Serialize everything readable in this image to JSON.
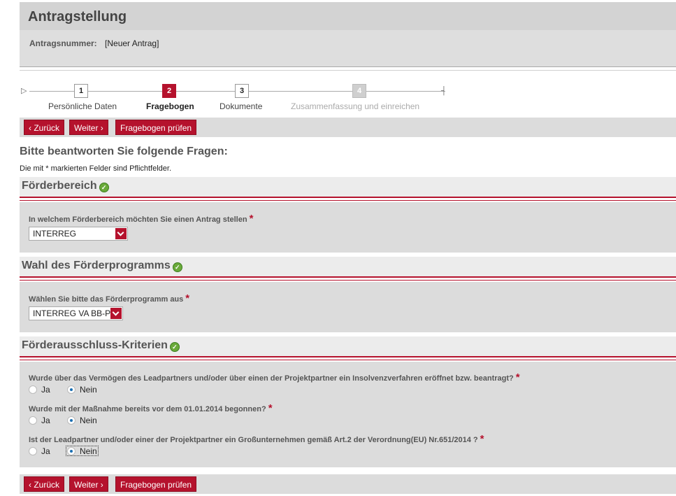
{
  "header": {
    "title": "Antragstellung",
    "antragsnummer_label": "Antragsnummer:",
    "antragsnummer_value": "[Neuer Antrag]"
  },
  "stepper": {
    "steps": [
      {
        "number": "1",
        "label": "Persönliche Daten",
        "state": "done"
      },
      {
        "number": "2",
        "label": "Fragebogen",
        "state": "active"
      },
      {
        "number": "3",
        "label": "Dokumente",
        "state": "available"
      },
      {
        "number": "4",
        "label": "Zusammenfassung und einreichen",
        "state": "disabled"
      }
    ]
  },
  "buttons": {
    "back": "Zurück",
    "next": "Weiter",
    "check": "Fragebogen prüfen"
  },
  "intro": {
    "title": "Bitte beantworten Sie folgende Fragen:",
    "note": "Die mit * markierten Felder sind Pflichtfelder."
  },
  "sections": {
    "foerderbereich": {
      "title": "Förderbereich",
      "question": "In welchem Förderbereich möchten Sie einen Antrag stellen",
      "selected": "INTERREG"
    },
    "programm": {
      "title": "Wahl des Förderprogramms",
      "question": "Wählen Sie bitte das Förderprogramm aus",
      "selected": "INTERREG VA BB-PL"
    },
    "ausschluss": {
      "title": "Förderausschluss-Kriterien",
      "questions": [
        {
          "text": "Wurde über das Vermögen des Leadpartners und/oder über einen der Projektpartner ein Insolvenzverfahren eröffnet bzw. beantragt?",
          "answer": "Nein"
        },
        {
          "text": "Wurde mit der Maßnahme bereits vor dem 01.01.2014 begonnen?",
          "answer": "Nein"
        },
        {
          "text": "Ist der Leadpartner und/oder einer der Projektpartner ein Großunternehmen gemäß Art.2 der Verordnung(EU) Nr.651/2014 ?",
          "answer": "Nein"
        }
      ],
      "option_yes": "Ja",
      "option_no": "Nein"
    }
  },
  "required_marker": "*",
  "colors": {
    "accent": "#b5122d",
    "check_green": "#6aaa3a",
    "panel_gray": "#dcdcdc"
  }
}
